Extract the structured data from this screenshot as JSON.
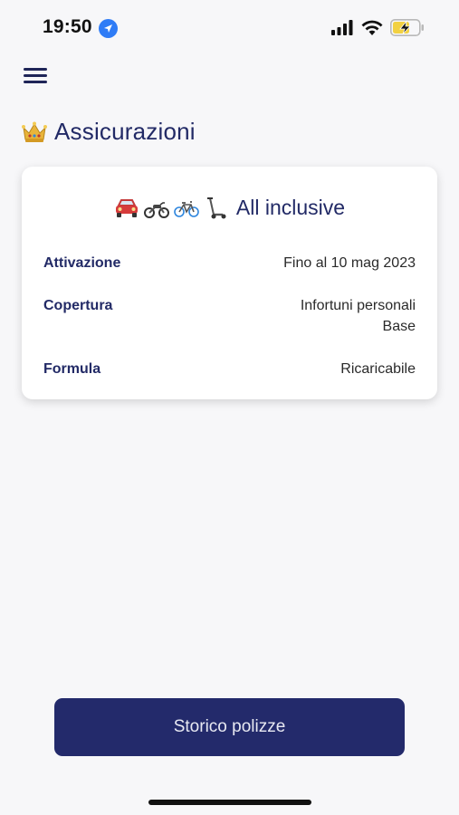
{
  "status_bar": {
    "time": "19:50",
    "icons": [
      "location-arrow-icon",
      "cellular-signal-icon",
      "wifi-icon",
      "battery-charging-icon"
    ]
  },
  "header": {
    "menu_icon": "hamburger-menu-icon",
    "title_icon": "crown-icon",
    "title": "Assicurazioni"
  },
  "card": {
    "vehicle_icons": [
      "car-icon",
      "motorcycle-icon",
      "bicycle-icon",
      "scooter-icon"
    ],
    "title": "All inclusive",
    "rows": [
      {
        "label": "Attivazione",
        "value": "Fino al 10 mag 2023"
      },
      {
        "label": "Copertura",
        "value_line1": "Infortuni personali",
        "value_line2": "Base"
      },
      {
        "label": "Formula",
        "value": "Ricaricabile"
      }
    ]
  },
  "footer": {
    "history_button": "Storico polizze"
  },
  "colors": {
    "primary": "#232a6b",
    "title": "#222a66",
    "background": "#f7f7f9",
    "card": "#ffffff"
  }
}
